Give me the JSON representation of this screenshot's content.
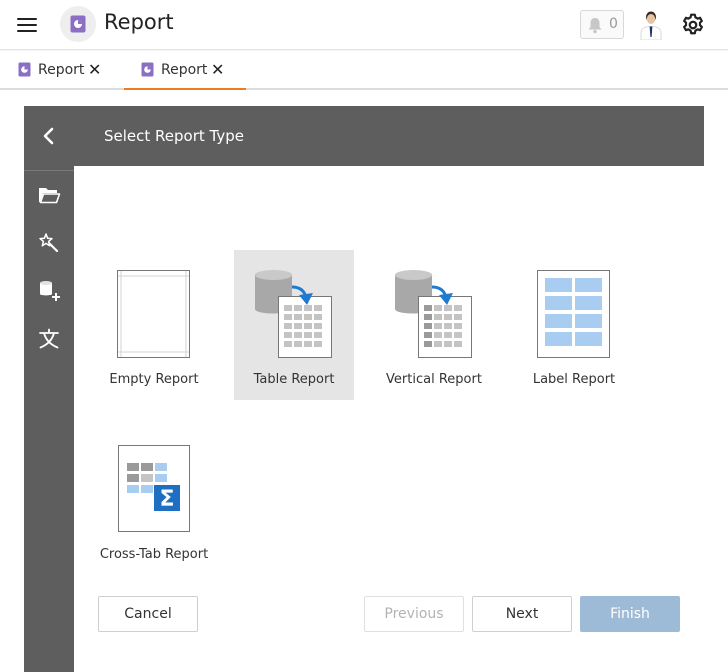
{
  "app": {
    "title": "Report",
    "notifications_count": "0"
  },
  "tabs": [
    {
      "label": "Report",
      "close": "✕",
      "active": false
    },
    {
      "label": "Report",
      "close": "✕",
      "active": true
    }
  ],
  "wizard": {
    "title": "Select Report Type",
    "rail": [
      {
        "icon": "folder-open-icon"
      },
      {
        "icon": "magic-wand-icon"
      },
      {
        "icon": "add-datasource-icon"
      },
      {
        "icon": "localization-icon"
      }
    ],
    "report_types": [
      {
        "label": "Empty Report",
        "icon": "empty-report-icon",
        "selected": false
      },
      {
        "label": "Table Report",
        "icon": "table-report-icon",
        "selected": true
      },
      {
        "label": "Vertical Report",
        "icon": "vertical-report-icon",
        "selected": false
      },
      {
        "label": "Label Report",
        "icon": "label-report-icon",
        "selected": false
      },
      {
        "label": "Cross-Tab Report",
        "icon": "cross-tab-report-icon",
        "selected": false
      }
    ],
    "buttons": {
      "cancel": "Cancel",
      "previous": "Previous",
      "next": "Next",
      "finish": "Finish"
    }
  },
  "colors": {
    "accent": "#ee7a21",
    "header": "#5e5e5e",
    "selected_tile": "#e5e5e5",
    "finish_disabled": "#9dbad6",
    "arrow_blue": "#1e7bd1",
    "sigma_blue": "#1e6fc2"
  }
}
